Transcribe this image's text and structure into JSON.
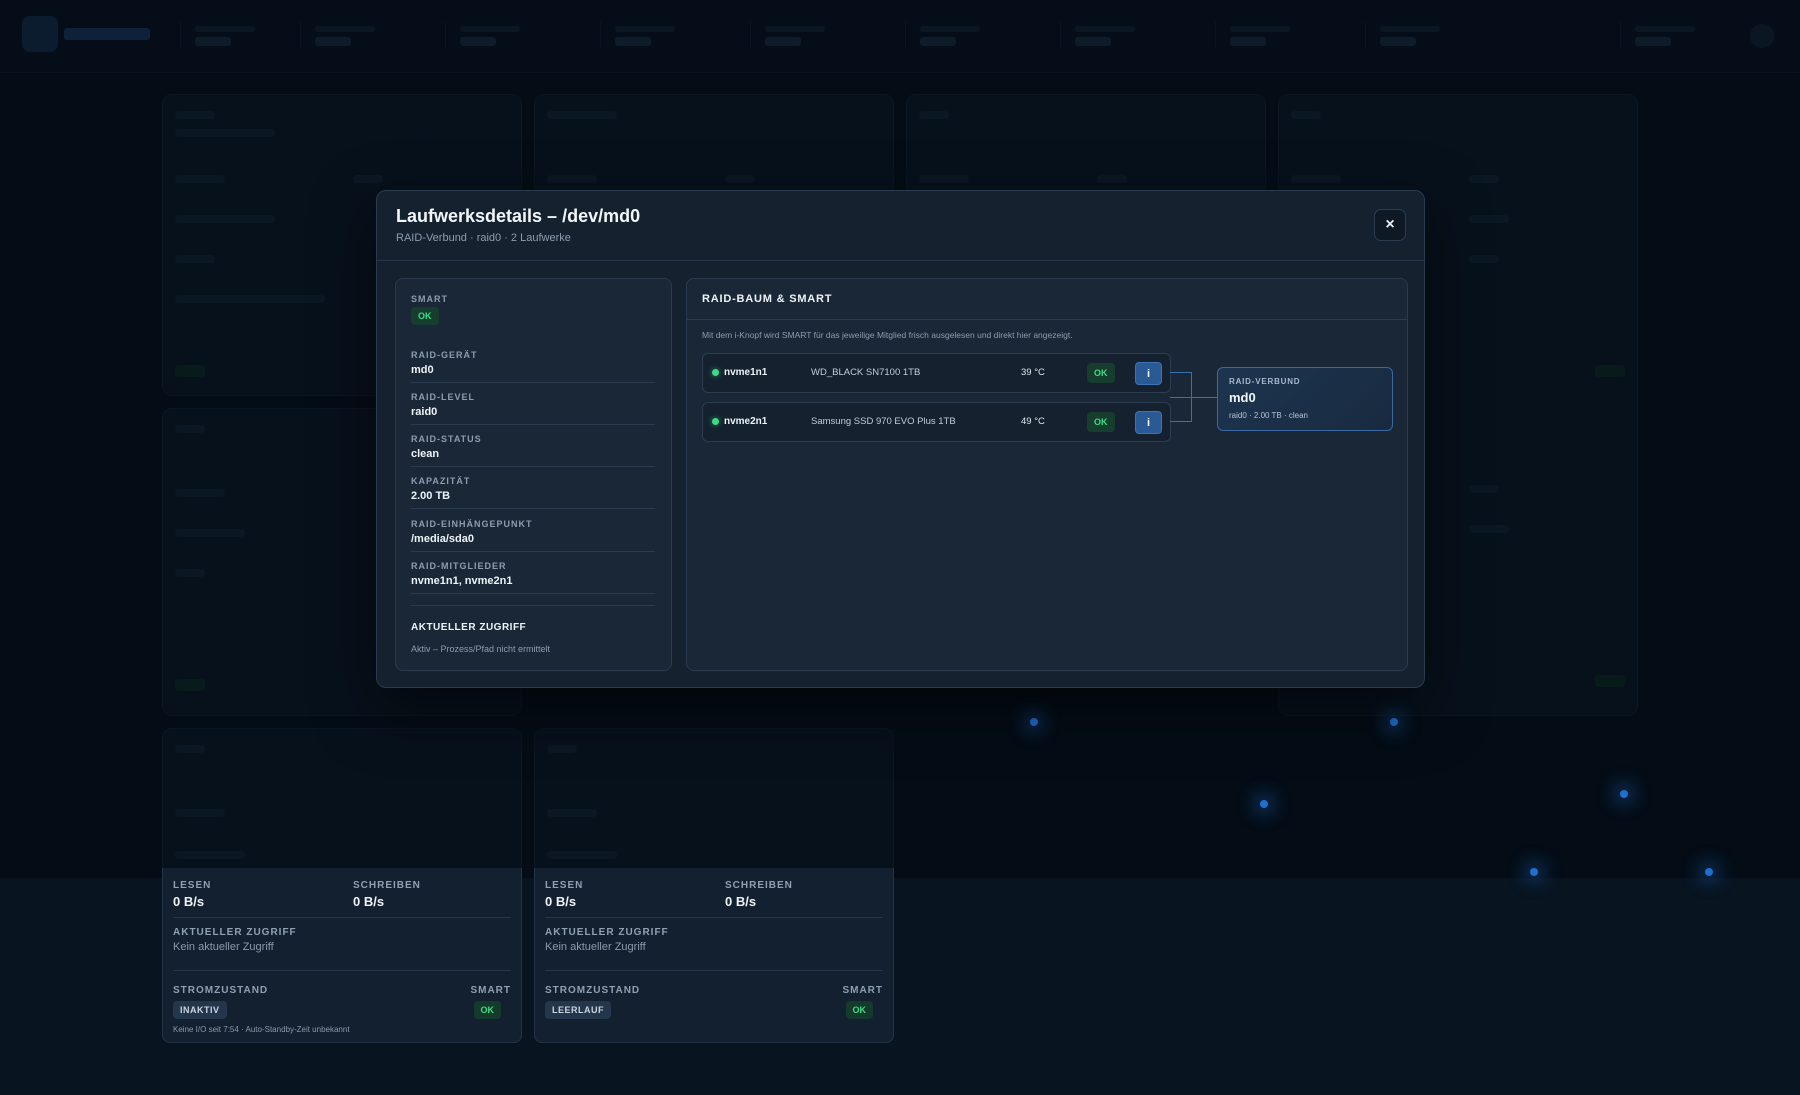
{
  "modal": {
    "title": "Laufwerksdetails – /dev/md0",
    "subtitle": "RAID-Verbund · raid0 · 2 Laufwerke",
    "close_label": "×"
  },
  "details": {
    "smart_label": "SMART",
    "smart_status": "OK",
    "fields": [
      {
        "label": "RAID-GERÄT",
        "value": "md0"
      },
      {
        "label": "RAID-LEVEL",
        "value": "raid0"
      },
      {
        "label": "RAID-STATUS",
        "value": "clean"
      },
      {
        "label": "KAPAZITÄT",
        "value": "2.00 TB"
      },
      {
        "label": "RAID-EINHÄNGEPUNKT",
        "value": "/media/sda0"
      },
      {
        "label": "RAID-MITGLIEDER",
        "value": "nvme1n1, nvme2n1"
      }
    ],
    "access_title": "AKTUELLER ZUGRIFF",
    "access_text": "Aktiv – Prozess/Pfad nicht ermittelt"
  },
  "raid_tree": {
    "title": "RAID-BAUM & SMART",
    "hint": "Mit dem i-Knopf wird SMART für das jeweilige Mitglied frisch ausgelesen und direkt hier angezeigt.",
    "members": [
      {
        "name": "nvme1n1",
        "model": "WD_BLACK SN7100 1TB",
        "temp": "39 °C",
        "status": "OK",
        "info_label": "i"
      },
      {
        "name": "nvme2n1",
        "model": "Samsung SSD 970 EVO Plus 1TB",
        "temp": "49 °C",
        "status": "OK",
        "info_label": "i"
      }
    ],
    "array": {
      "label": "RAID-VERBUND",
      "name": "md0",
      "meta": "raid0 · 2.00 TB · clean"
    }
  },
  "lower_cards": [
    {
      "read_label": "LESEN",
      "read_value": "0 B/s",
      "write_label": "SCHREIBEN",
      "write_value": "0 B/s",
      "access_label": "AKTUELLER ZUGRIFF",
      "access_value": "Kein aktueller Zugriff",
      "power_label": "STROMZUSTAND",
      "power_state": "INAKTIV",
      "smart_label": "SMART",
      "smart_status": "OK",
      "footnote": "Keine I/O seit 7:54 · Auto-Standby-Zeit unbekannt"
    },
    {
      "read_label": "LESEN",
      "read_value": "0 B/s",
      "write_label": "SCHREIBEN",
      "write_value": "0 B/s",
      "access_label": "AKTUELLER ZUGRIFF",
      "access_value": "Kein aktueller Zugriff",
      "power_label": "STROMZUSTAND",
      "power_state": "LEERLAUF",
      "smart_label": "SMART",
      "smart_status": "OK"
    }
  ],
  "colors": {
    "ok_green": "#3ddc84",
    "info_blue": "#2a5a96",
    "background": "#081420"
  }
}
